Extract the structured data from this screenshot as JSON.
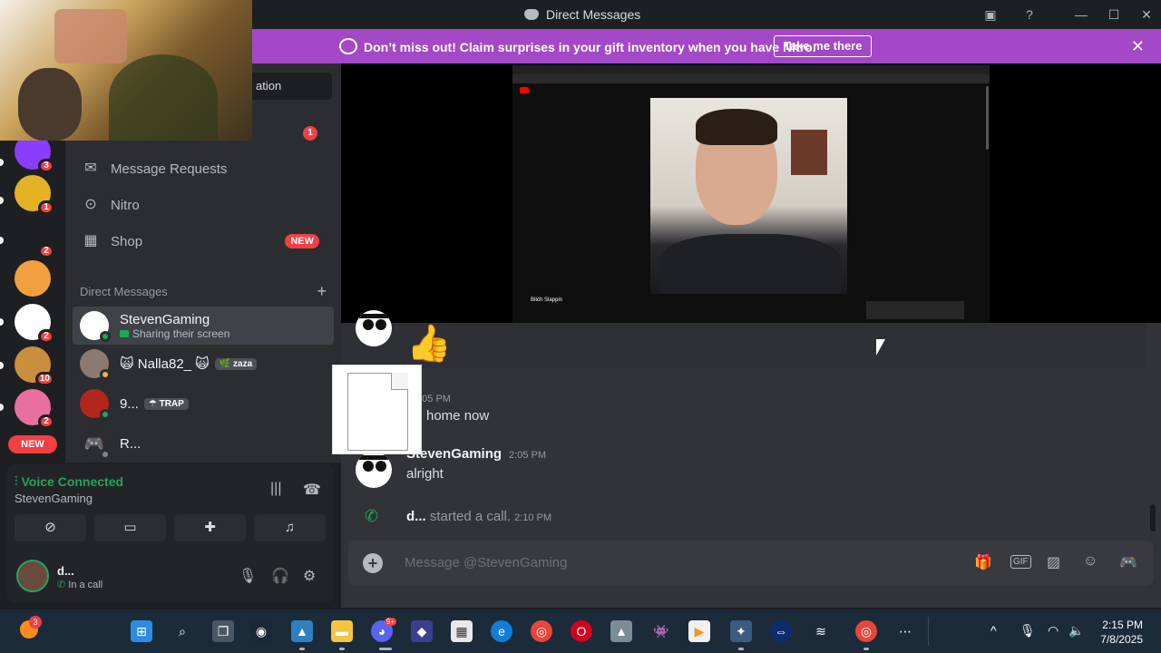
{
  "window": {
    "title": "Direct Messages",
    "controls": {
      "minimize": "—",
      "maximize": "☐",
      "close": "✕"
    }
  },
  "banner": {
    "text": "Don’t miss out! Claim surprises in your gift inventory when you have Nitro.",
    "button": "Take me there",
    "close": "✕"
  },
  "sidebar": {
    "find_button": "ation",
    "friends_badge": "1",
    "nav": [
      {
        "label": "Message Requests",
        "icon": "envelope-icon"
      },
      {
        "label": "Nitro",
        "icon": "nitro-icon"
      },
      {
        "label": "Shop",
        "icon": "shop-icon",
        "tag": "NEW"
      }
    ],
    "dm_header": "Direct Messages",
    "dms": [
      {
        "name": "StevenGaming",
        "sub": "Sharing their screen"
      },
      {
        "name": "🙀 Nalla82_ 🙀",
        "tag": "🌿 zaza"
      },
      {
        "name": "9...",
        "tag": "☂ TRAP"
      },
      {
        "name": "R..."
      }
    ]
  },
  "servers": [
    {
      "badge": "3",
      "color": "#8b3dff"
    },
    {
      "badge": "1",
      "color": "#e4b325"
    },
    {
      "badge": "2",
      "color": "#1e1f22"
    },
    {
      "badge": "",
      "color": "#f2a03d"
    },
    {
      "badge": "2",
      "color": "#ffffff"
    },
    {
      "badge": "10",
      "color": "#c98f3d"
    },
    {
      "badge": "2",
      "color": "#e86fa0"
    }
  ],
  "servers_new": "NEW",
  "voice": {
    "status": "Voice Connected",
    "channel": "StevenGaming"
  },
  "user": {
    "name": "d...",
    "status": "In a call"
  },
  "messages": [
    {
      "time": "2:05 PM",
      "text": "home now"
    },
    {
      "author": "StevenGaming",
      "time": "2:05 PM",
      "text": "alright"
    }
  ],
  "thumbs": "👍",
  "call": {
    "user": "d...",
    "text": "started a call.",
    "time": "2:10 PM"
  },
  "composer": {
    "placeholder": "Message @StevenGaming"
  },
  "stream": {
    "video_title": "Bitch Slappin"
  },
  "taskbar": {
    "time": "2:15 PM",
    "date": "7/8/2025",
    "weather_badge": "3",
    "discord_badge": "9+"
  }
}
